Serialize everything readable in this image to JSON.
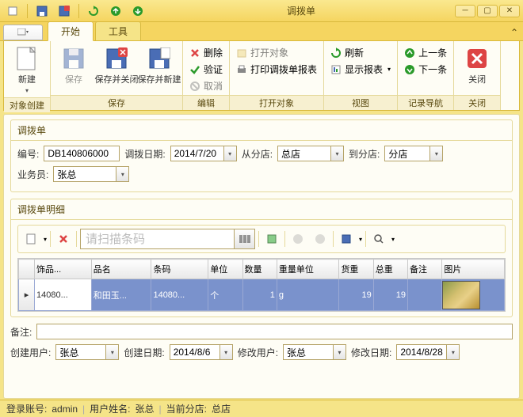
{
  "window": {
    "title": "调拨单"
  },
  "tabs": {
    "start": "开始",
    "tools": "工具"
  },
  "ribbon": {
    "groups": {
      "create": {
        "label": "对象创建",
        "new": "新建"
      },
      "save": {
        "label": "保存",
        "save": "保存",
        "saveclose": "保存并关闭",
        "savenew": "保存并新建"
      },
      "edit": {
        "label": "编辑",
        "delete": "删除",
        "validate": "验证",
        "cancel": "取消"
      },
      "open": {
        "label": "打开对象",
        "open": "打开对象",
        "print": "打印调拨单报表"
      },
      "view": {
        "label": "视图",
        "refresh": "刷新",
        "showreport": "显示报表"
      },
      "nav": {
        "label": "记录导航",
        "prev": "上一条",
        "next": "下一条"
      },
      "close": {
        "label": "关闭",
        "close": "关闭"
      }
    }
  },
  "header": {
    "section": "调拨单",
    "fields": {
      "no_label": "编号:",
      "no": "DB140806000",
      "date_label": "调拨日期:",
      "date": "2014/7/20",
      "from_label": "从分店:",
      "from": "总店",
      "to_label": "到分店:",
      "to": "分店",
      "sales_label": "业务员:",
      "sales": "张总"
    }
  },
  "detail": {
    "section": "调拨单明细",
    "search_placeholder": "请扫描条码",
    "columns": [
      "饰品...",
      "品名",
      "条码",
      "单位",
      "数量",
      "重量单位",
      "货重",
      "总重",
      "备注",
      "图片"
    ],
    "row": {
      "code": "14080...",
      "name": "和田玉...",
      "barcode": "14080...",
      "unit": "个",
      "qty": "1",
      "wunit": "g",
      "weight": "19",
      "total": "19",
      "remark": ""
    }
  },
  "footer": {
    "remark_label": "备注:",
    "cu_label": "创建用户:",
    "cu": "张总",
    "cd_label": "创建日期:",
    "cd": "2014/8/6",
    "mu_label": "修改用户:",
    "mu": "张总",
    "md_label": "修改日期:",
    "md": "2014/8/28"
  },
  "status": {
    "account_label": "登录账号:",
    "account": "admin",
    "user_label": "用户姓名:",
    "user": "张总",
    "store_label": "当前分店:",
    "store": "总店"
  }
}
